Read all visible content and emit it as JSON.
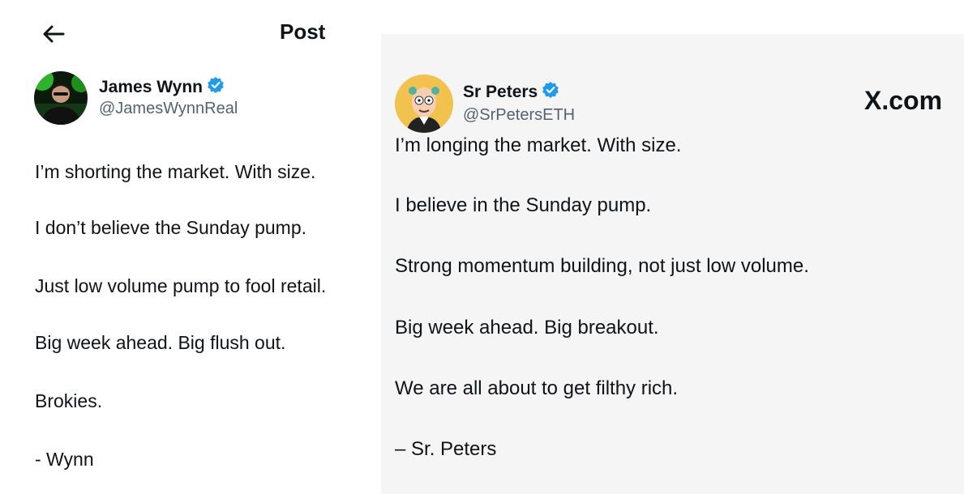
{
  "left_post": {
    "header_title": "Post",
    "author": {
      "name": "James Wynn",
      "handle": "@JamesWynnReal"
    },
    "lines": [
      "I’m shorting the market. With size.",
      "I don’t believe the Sunday pump.",
      "Just low volume pump to fool retail.",
      "Big week ahead. Big flush out.",
      "Brokies.",
      "- Wynn"
    ]
  },
  "right_post": {
    "author": {
      "name": "Sr Peters",
      "handle": "@SrPetersETH"
    },
    "watermark": "X.com",
    "lines": [
      "I’m longing the market. With size.",
      "I believe in the Sunday pump.",
      "Strong momentum building, not just low volume.",
      "Big week ahead. Big breakout.",
      "We are all about to get filthy rich.",
      "– Sr. Peters"
    ]
  },
  "colors": {
    "verified": "#1d9bf0",
    "handle": "#536471",
    "text": "#0f1419"
  },
  "icons": {
    "back": "arrow-left-icon",
    "verified": "verified-badge-icon"
  }
}
